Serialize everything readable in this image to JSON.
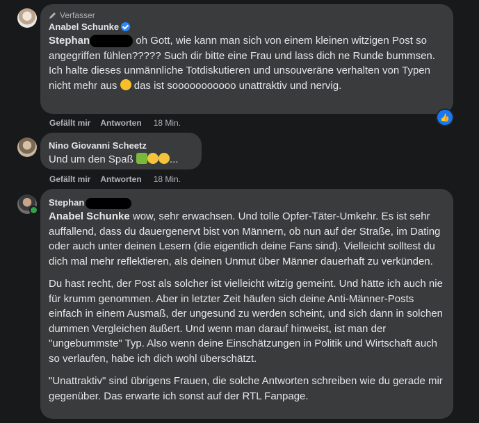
{
  "comment1": {
    "role": "Verfasser",
    "author": "Anabel Schunke",
    "mention": "Stephan",
    "body": "oh Gott, wie kann man sich von einem kleinen witzigen Post so angegriffen fühlen????? Such dir bitte eine Frau und lass dich ne Runde bummsen. Ich halte dieses unmännliche Totdiskutieren und unsouveräne verhalten von Typen nicht mehr aus",
    "body_after_emoji": "das ist sooooooooooo unattraktiv und nervig.",
    "like": "Gefällt mir",
    "reply": "Antworten",
    "time": "18 Min."
  },
  "comment2": {
    "author": "Nino Giovanni Scheetz",
    "body": "Und um den Spaß",
    "like": "Gefällt mir",
    "reply": "Antworten",
    "time": "18 Min."
  },
  "comment3": {
    "author": "Stephan",
    "mention": "Anabel Schunke",
    "p1": "wow, sehr erwachsen. Und tolle Opfer-Täter-Umkehr. Es ist sehr auffallend, dass du dauergenervt bist von Männern, ob nun auf der Straße, im Dating oder auch unter deinen Lesern (die eigentlich deine Fans sind). Vielleicht solltest du dich mal mehr reflektieren, als deinen Unmut über Männer dauerhaft zu verkünden.",
    "p2": "Du hast recht, der Post als solcher ist vielleicht witzig gemeint. Und hätte ich auch nie für krumm genommen. Aber in letzter Zeit häufen sich deine Anti-Männer-Posts einfach in einem Ausmaß, der ungesund zu werden scheint, und sich dann in solchen dummen Vergleichen äußert. Und wenn man darauf hinweist, ist man der \"ungebummste\" Typ. Also wenn deine Einschätzungen in Politik und Wirtschaft auch so verlaufen, habe ich dich wohl überschätzt.",
    "p3": "\"Unattraktiv\" sind übrigens Frauen, die solche Antworten schreiben wie du gerade mir gegenüber. Das erwarte ich sonst auf der RTL Fanpage."
  }
}
